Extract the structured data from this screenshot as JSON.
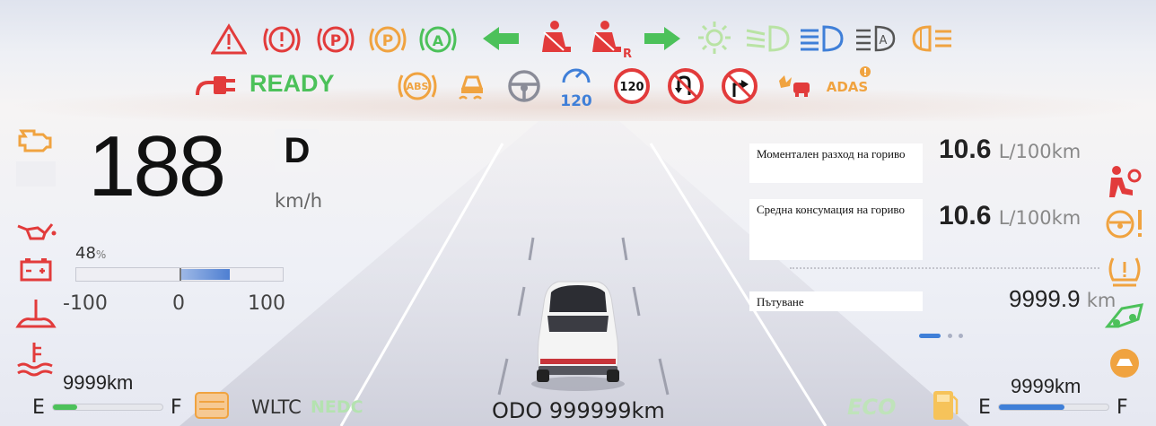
{
  "status": {
    "ready_label": "READY",
    "abs_label": "ABS",
    "speed_limit_set": "120",
    "speed_limit_sign": "120",
    "adas_label": "ADAS",
    "rear_belt_label": "R"
  },
  "speed": {
    "value": "188",
    "unit": "km/h",
    "gear": "D"
  },
  "power": {
    "percent": "48",
    "percent_sign": "%",
    "level": 0.48,
    "scale_min": "-100",
    "scale_mid": "0",
    "scale_max": "100"
  },
  "trip_info": {
    "instant_label": "Моментален разход на гориво",
    "instant_value": "10.6",
    "instant_unit": "L/100km",
    "avg_label": "Средна консумация на гориво",
    "avg_value": "10.6",
    "avg_unit": "L/100km",
    "trip_label": "Пътуване",
    "trip_value": "9999.9",
    "trip_unit": "km"
  },
  "range_left": {
    "value": "9999km",
    "e": "E",
    "f": "F",
    "level": 0.22
  },
  "range_right": {
    "value": "9999km",
    "e": "E",
    "f": "F",
    "level": 0.6
  },
  "wltc_label": "WLTC",
  "wltc_mode": "NEDC",
  "eco_label": "ECO",
  "odo": {
    "label": "ODO",
    "value": "999999",
    "unit": "km"
  },
  "colors": {
    "red": "#e23b3b",
    "orange": "#f0a340",
    "green": "#4cc15a",
    "blue": "#3f7fd8"
  }
}
